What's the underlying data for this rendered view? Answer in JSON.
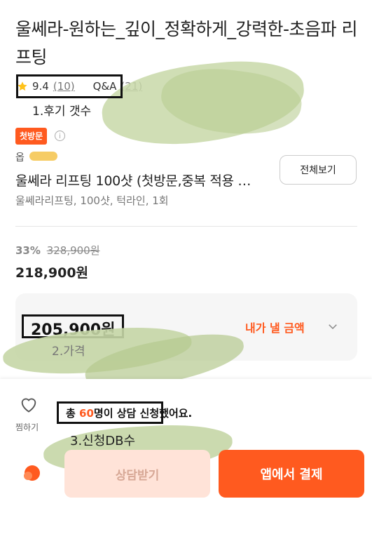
{
  "product": {
    "title": "울쎄라-원하는_깊이_정확하게_강력한-초음파 리프팅"
  },
  "rating": {
    "score": "9.4",
    "review_count": "(10)",
    "qna_label": "Q&A",
    "qna_count": "(21)"
  },
  "annotations": {
    "review_count": "1.후기 갯수",
    "price": "2.가격",
    "applications": "3.신청DB수"
  },
  "option": {
    "badge": "첫방문",
    "label": "옵",
    "name": "울쎄라 리프팅 100샷 (첫방문,중복 적용 …",
    "detail": "울쎄라리프팅, 100샷, 턱라인, 1회",
    "view_all": "전체보기"
  },
  "price": {
    "discount": "33%",
    "original": "328,900원",
    "sale": "218,900원",
    "final": "205,900원",
    "final_label": "내가 낼 금액"
  },
  "bottom": {
    "wish_label": "찜하기",
    "apply_prefix": "총 ",
    "apply_count": "60",
    "apply_suffix": "명이 상담 신청했어요.",
    "consult_button": "상담받기",
    "pay_button": "앱에서 결제"
  },
  "colors": {
    "accent": "#ff5a1f",
    "annotation_brush": "#c5d6a6"
  }
}
